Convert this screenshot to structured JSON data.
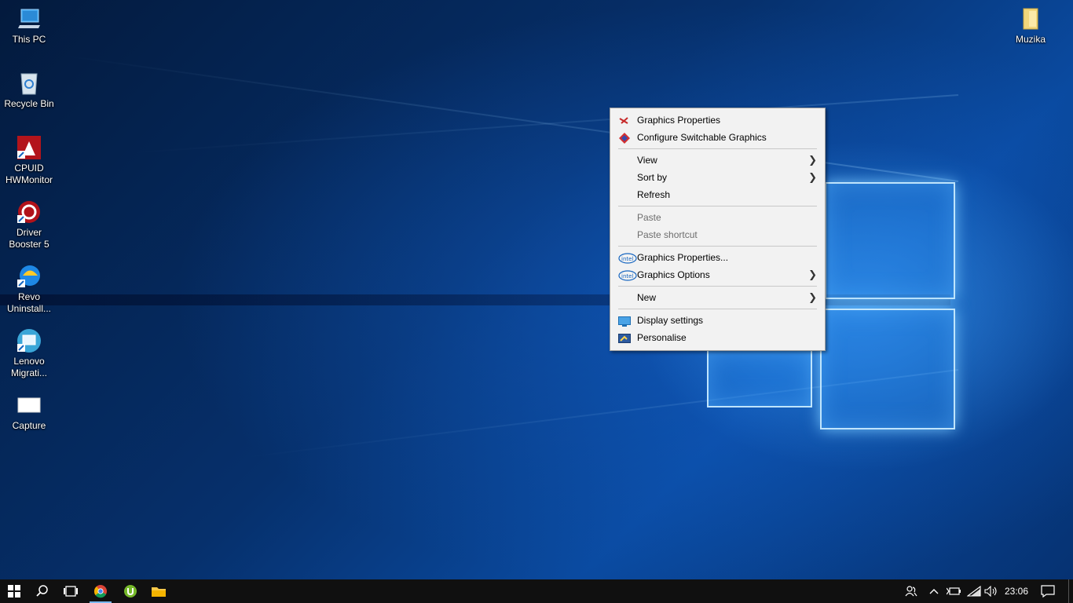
{
  "desktop": {
    "icons": [
      {
        "label": "This PC"
      },
      {
        "label": "Recycle Bin"
      },
      {
        "label": "CPUID\nHWMonitor"
      },
      {
        "label": "Driver\nBooster 5"
      },
      {
        "label": "Revo\nUninstall..."
      },
      {
        "label": "Lenovo\nMigrati..."
      },
      {
        "label": "Capture"
      },
      {
        "label": "Muzika"
      }
    ]
  },
  "context_menu": {
    "items": [
      {
        "label": "Graphics Properties",
        "icon": "amd-graphics-icon"
      },
      {
        "label": "Configure Switchable Graphics",
        "icon": "amd-switchable-icon"
      },
      {
        "label": "View",
        "submenu": true
      },
      {
        "label": "Sort by",
        "submenu": true
      },
      {
        "label": "Refresh"
      },
      {
        "label": "Paste",
        "disabled": true
      },
      {
        "label": "Paste shortcut",
        "disabled": true
      },
      {
        "label": "Graphics Properties...",
        "icon": "intel-icon"
      },
      {
        "label": "Graphics Options",
        "icon": "intel-icon",
        "submenu": true
      },
      {
        "label": "New",
        "submenu": true
      },
      {
        "label": "Display settings",
        "icon": "display-icon"
      },
      {
        "label": "Personalise",
        "icon": "personalise-icon"
      }
    ],
    "intel_text": "intel"
  },
  "taskbar": {
    "clock": "23:06",
    "pinned": [
      "start-icon",
      "search-icon",
      "task-view-icon",
      "chrome-icon",
      "utorrent-icon",
      "file-explorer-icon"
    ],
    "tray": [
      "people-icon",
      "chevron-up-icon",
      "battery-icon",
      "wifi-icon",
      "volume-icon",
      "action-center-icon"
    ]
  },
  "colors": {
    "menu_bg": "#f2f2f2",
    "taskbar_bg": "#101010",
    "accent": "#7ab8f0"
  }
}
